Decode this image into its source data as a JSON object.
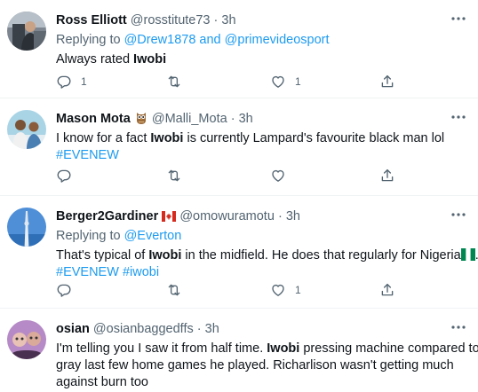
{
  "tweets": [
    {
      "name": "Ross Elliott",
      "handle": "@rosstitute73",
      "time": "3h",
      "reply_label": "Replying to",
      "reply_to_1": "@Drew1878",
      "reply_and": "and",
      "reply_to_2": "@primevideosport",
      "text_1": "Always rated ",
      "text_bold": "Iwobi",
      "reply_count": "1",
      "retweet_count": "",
      "like_count": "1"
    },
    {
      "name": "Mason Mota",
      "handle": "@Malli_Mota",
      "time": "3h",
      "text_1": "I know for a fact ",
      "text_bold": "Iwobi",
      "text_2": " is currently Lampard's favourite black man lol",
      "hashtags": "#EVENEW",
      "reply_count": "",
      "retweet_count": "",
      "like_count": ""
    },
    {
      "name": "Berger2Gardiner",
      "handle": "@omowuramotu",
      "time": "3h",
      "reply_label": "Replying to",
      "reply_to_1": "@Everton",
      "text_1": "That's typical of ",
      "text_bold": "Iwobi",
      "text_2": " in the midfield. He does that regularly for Nigeria",
      "hashtag_1": "#EVENEW",
      "hashtag_2": "#iwobi",
      "reply_count": "",
      "retweet_count": "",
      "like_count": "1"
    },
    {
      "name": "osian",
      "handle": "@osianbaggedffs",
      "time": "3h",
      "text_1": "I'm telling you I saw it from half time. ",
      "text_bold": "Iwobi",
      "text_2": " pressing machine compared to",
      "text_3": "gray last few home games he played. Richarlison wasn't getting much",
      "text_4": "against burn too"
    }
  ],
  "ui": {
    "separator": "·",
    "icons": [
      "reply-icon",
      "retweet-icon",
      "like-icon",
      "share-icon",
      "more-icon",
      "owl-emoji-icon",
      "canada-flag-icon",
      "nigeria-flag-icon"
    ],
    "colors": {
      "link": "#1d9bf0",
      "secondary": "#536471",
      "text": "#0f1419",
      "border": "#eff3f4"
    }
  }
}
